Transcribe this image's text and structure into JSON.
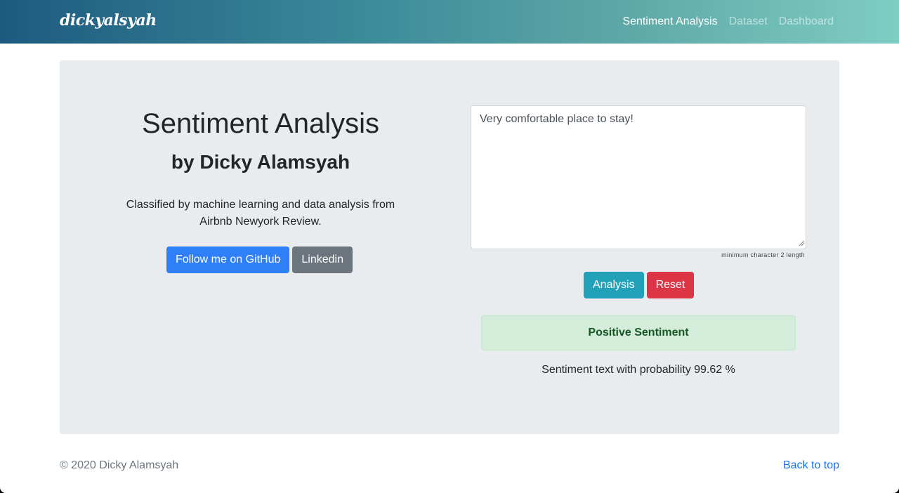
{
  "navbar": {
    "brand": "dickyalsyah",
    "links": [
      "Sentiment Analysis",
      "Dataset",
      "Dashboard"
    ]
  },
  "hero": {
    "title": "Sentiment Analysis",
    "subtitle": "by Dicky Alamsyah",
    "description": "Classified by machine learning and data analysis from Airbnb Newyork Review.",
    "github_label": "Follow me on GitHub",
    "linkedin_label": "Linkedin"
  },
  "form": {
    "text_value": "Very comfortable place to stay!",
    "hint": "minimum character 2 length",
    "analysis_label": "Analysis",
    "reset_label": "Reset"
  },
  "result": {
    "label": "Positive Sentiment",
    "probability_text": "Sentiment text with probability 99.62 %"
  },
  "footer": {
    "copyright": "© 2020 Dicky Alamsyah",
    "back_to_top": "Back to top"
  },
  "colors": {
    "primary": "#2f7ff8",
    "secondary": "#6c757d",
    "info": "#22a2b8",
    "danger": "#dc3545",
    "success_bg": "#d4edda",
    "success_text": "#155724"
  }
}
